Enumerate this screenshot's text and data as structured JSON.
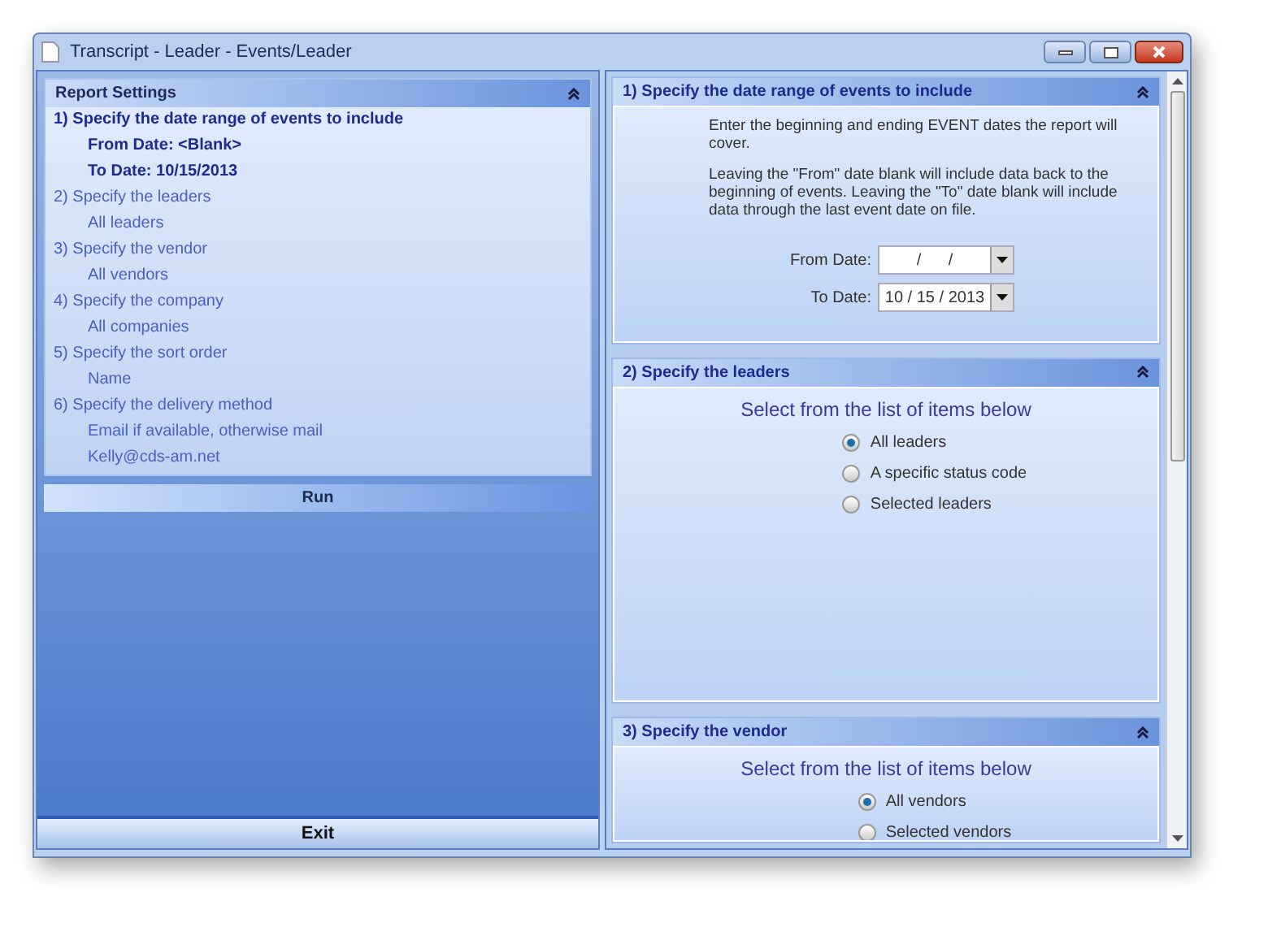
{
  "window": {
    "title": "Transcript - Leader - Events/Leader"
  },
  "summary": {
    "title": "Report Settings",
    "steps": [
      {
        "label": "1)  Specify the date range of events to include",
        "active": true,
        "details": [
          "From Date:  <Blank>",
          "To Date:  10/15/2013"
        ]
      },
      {
        "label": "2)  Specify the leaders",
        "active": false,
        "details": [
          "All leaders"
        ]
      },
      {
        "label": "3)  Specify the vendor",
        "active": false,
        "details": [
          "All vendors"
        ]
      },
      {
        "label": "4)  Specify the company",
        "active": false,
        "details": [
          "All companies"
        ]
      },
      {
        "label": "5)  Specify the sort order",
        "active": false,
        "details": [
          "Name"
        ]
      },
      {
        "label": "6)  Specify the delivery method",
        "active": false,
        "details": [
          "Email if available, otherwise mail",
          "Kelly@cds-am.net"
        ]
      }
    ]
  },
  "run_button": "Run",
  "exit_button": "Exit",
  "sections": [
    {
      "kind": "dates",
      "title": "1)  Specify the date range of events to include",
      "paragraphs": [
        "Enter the beginning and ending EVENT dates the report will cover.",
        "Leaving the \"From\" date blank will include data back to the beginning of events.  Leaving the \"To\" date blank will include data through the last event date on file."
      ],
      "fields": [
        {
          "label": "From Date:",
          "value": "/      /"
        },
        {
          "label": "To Date:",
          "value": "10 / 15 / 2013"
        }
      ]
    },
    {
      "kind": "choices",
      "title": "2)  Specify the leaders",
      "prompt": "Select from the list of items below",
      "options": [
        {
          "label": "All leaders",
          "selected": true
        },
        {
          "label": "A specific status code",
          "selected": false
        },
        {
          "label": "Selected leaders",
          "selected": false
        }
      ]
    },
    {
      "kind": "choices",
      "title": "3)  Specify the vendor",
      "prompt": "Select from the list of items below",
      "options": [
        {
          "label": "All vendors",
          "selected": true
        },
        {
          "label": "Selected vendors",
          "selected": false
        }
      ]
    }
  ]
}
